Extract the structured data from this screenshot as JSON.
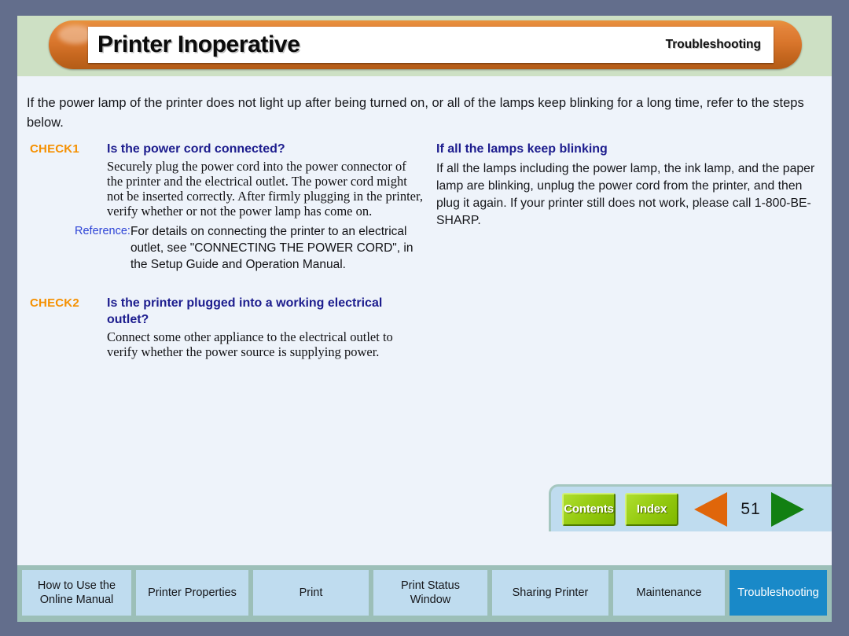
{
  "header": {
    "title": "Printer Inoperative",
    "section": "Troubleshooting"
  },
  "content": {
    "intro": "If the power lamp of the printer does not light up after being turned on, or all of the lamps keep blinking for a long time, refer to the steps below.",
    "checks": [
      {
        "label": "CHECK1",
        "question": "Is the power cord connected?",
        "body": "Securely plug the power cord into the power connector of the printer and the electrical outlet. The power cord might not be inserted correctly. After firmly plugging in the printer, verify whether or not the power lamp has come on.",
        "reference_label": "Reference:",
        "reference_text": "For details on connecting the printer to an electrical outlet, see \"CONNECTING THE POWER CORD\", in the Setup Guide and Operation Manual."
      },
      {
        "label": "CHECK2",
        "question": "Is the printer plugged into a working electrical outlet?",
        "body": "Connect some other appliance to the electrical outlet to verify whether the power source is supplying power."
      }
    ],
    "right_column": {
      "heading": "If all the lamps keep blinking",
      "body": "If all the lamps including the power lamp, the ink lamp, and the paper lamp are blinking, unplug the power cord from the printer, and then plug it again. If your printer still does not work, please call 1-800-BE-SHARP."
    }
  },
  "nav": {
    "contents_label": "Contents",
    "index_label": "Index",
    "prev_icon": "left-triangle-arrow-icon",
    "next_icon": "right-triangle-arrow-icon",
    "page_number": "51"
  },
  "tabs": [
    {
      "label": "How to Use the\nOnline Manual",
      "line1": "How to Use the",
      "line2": "Online Manual",
      "active": false
    },
    {
      "label": "Printer Properties",
      "line1": "Printer Properties",
      "line2": "",
      "active": false
    },
    {
      "label": "Print",
      "line1": "Print",
      "line2": "",
      "active": false
    },
    {
      "label": "Print Status\nWindow",
      "line1": "Print Status",
      "line2": "Window",
      "active": false
    },
    {
      "label": "Sharing Printer",
      "line1": "Sharing Printer",
      "line2": "",
      "active": false
    },
    {
      "label": "Maintenance",
      "line1": "Maintenance",
      "line2": "",
      "active": false
    },
    {
      "label": "Troubleshooting",
      "line1": "Troubleshooting",
      "line2": "",
      "active": true
    }
  ],
  "colors": {
    "outer_frame": "#636e8c",
    "header_band": "#cde0c4",
    "header_pill": "#d9762c",
    "page_background": "#eef3fa",
    "check_label": "#f59000",
    "heading_blue": "#1d1d8e",
    "reference_blue": "#2d43d6",
    "tab_inactive": "#bfdcef",
    "tab_active": "#1989c8",
    "tabbar_band": "#9cbfb8",
    "nav_button_green": "#97cc12",
    "prev_arrow_orange": "#e0660a",
    "next_arrow_green": "#128012"
  }
}
